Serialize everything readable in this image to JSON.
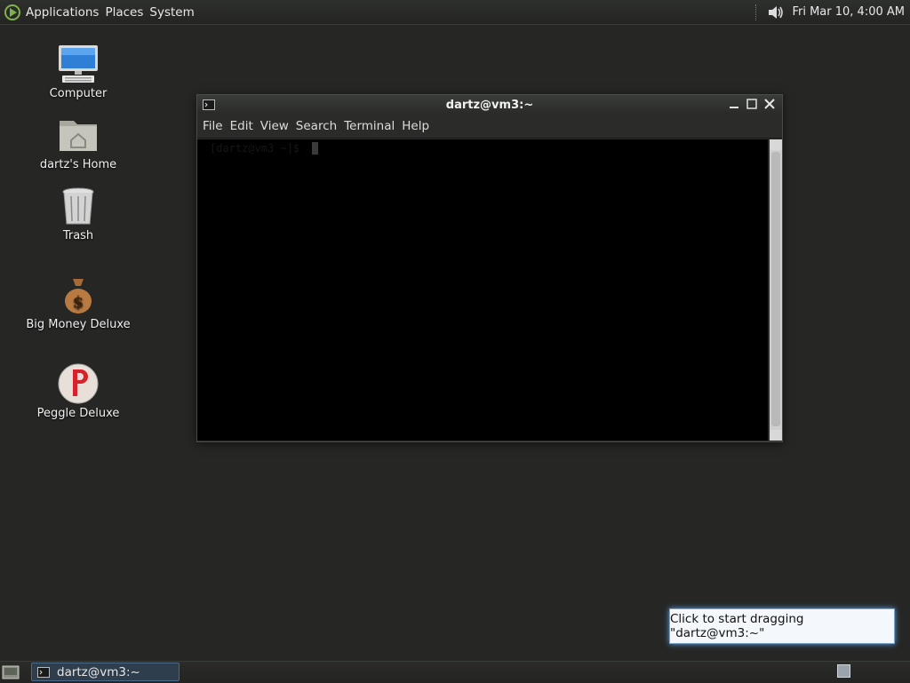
{
  "top_panel": {
    "menus": [
      "Applications",
      "Places",
      "System"
    ],
    "clock": "Fri Mar 10,  4:00 AM",
    "icons": {
      "logo": "distro-logo-icon",
      "volume": "volume-icon"
    }
  },
  "desktop": {
    "icons": [
      {
        "label": "Computer",
        "icon": "computer-icon"
      },
      {
        "label": "dartz's Home",
        "icon": "home-folder-icon"
      },
      {
        "label": "Trash",
        "icon": "trash-icon"
      },
      {
        "label": "Big Money Deluxe",
        "icon": "money-bag-icon"
      },
      {
        "label": "Peggle Deluxe",
        "icon": "peggle-icon"
      }
    ]
  },
  "terminal": {
    "title": "dartz@vm3:~",
    "menu": [
      "File",
      "Edit",
      "View",
      "Search",
      "Terminal",
      "Help"
    ],
    "prompt": "[dartz@vm3 ~]$ "
  },
  "tooltip": {
    "text": "Click to start dragging \"dartz@vm3:~\""
  },
  "bottom_panel": {
    "task_label": "dartz@vm3:~"
  },
  "colors": {
    "desktop_bg": "#262725",
    "accent": "#5aa0e8",
    "terminal_bg": "#000000"
  }
}
